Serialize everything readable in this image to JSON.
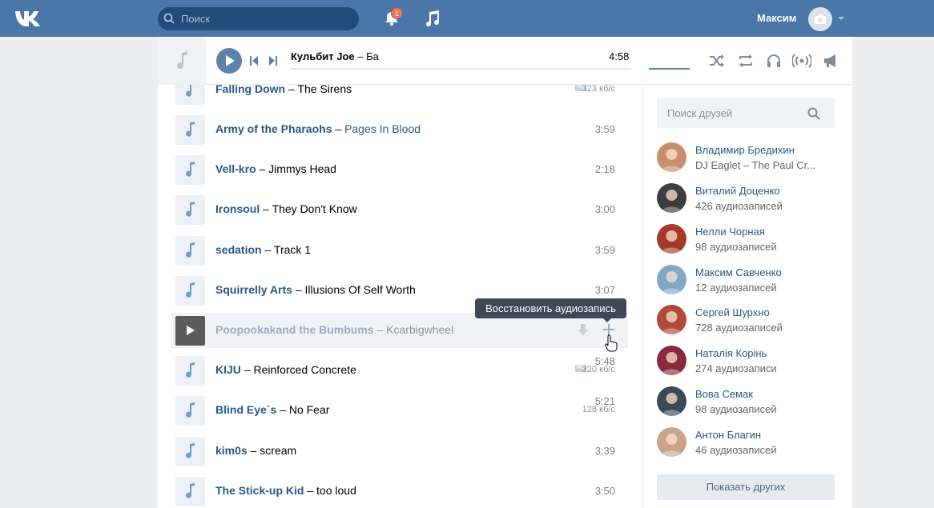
{
  "header": {
    "search_placeholder": "Поиск",
    "notifications_count": "1",
    "user_name": "Максим"
  },
  "player": {
    "artist": "Кульбит Joe",
    "separator": " – ",
    "song": "Ба",
    "time": "4:58"
  },
  "tracks": [
    {
      "artist": "Falling Down",
      "song": "The Sirens",
      "duration": "5:14",
      "bitrate": "323 кб/с",
      "hq": true
    },
    {
      "artist": "Army of the Pharaohs",
      "song": "Pages In Blood",
      "duration": "3:59",
      "song_link": true
    },
    {
      "artist": "Vell-kro",
      "song": "Jimmys Head",
      "duration": "2:18"
    },
    {
      "artist": "Ironsoul",
      "song": "They Don't Know",
      "duration": "3:00"
    },
    {
      "artist": "sedation",
      "song": "Track 1",
      "duration": "3:59"
    },
    {
      "artist": "Squirrelly Arts",
      "song": "Illusions Of Self Worth",
      "duration": "3:07"
    },
    {
      "artist": "Poopookakand the Bumbums",
      "song": "Kcarbigwheel",
      "duration": "",
      "deleted": true
    },
    {
      "artist": "KIJU",
      "song": "Reinforced Concrete",
      "duration": "5:48",
      "bitrate": "320 кб/с",
      "hq": true
    },
    {
      "artist": "Blind Eye`s",
      "song": "No Fear",
      "duration": "5:21",
      "bitrate": "128 кб/с"
    },
    {
      "artist": "kim0s",
      "song": "scream",
      "duration": "3:39"
    },
    {
      "artist": "The Stick-up Kid",
      "song": "too loud",
      "duration": "3:50"
    }
  ],
  "tooltip": "Восстановить аудиозапись",
  "hq_label": "HQ",
  "dash": "–",
  "sidebar": {
    "search_placeholder": "Поиск друзей",
    "friends": [
      {
        "name": "Владимир Бредихин",
        "sub": "DJ Eaglet – The Paul Cr...",
        "color": "#c98e6b"
      },
      {
        "name": "Виталий Доценко",
        "sub": "426 аудиозаписей",
        "color": "#3d3d3d"
      },
      {
        "name": "Нелли Чорная",
        "sub": "98 аудиозаписей",
        "color": "#a33a2a"
      },
      {
        "name": "Максим Савченко",
        "sub": "12 аудиозаписей",
        "color": "#7fa8c9"
      },
      {
        "name": "Сергей Шурхно",
        "sub": "728 аудиозаписей",
        "color": "#b04a3a"
      },
      {
        "name": "Наталія Корінь",
        "sub": "274 аудиозаписи",
        "color": "#8a2a3a"
      },
      {
        "name": "Вова Семак",
        "sub": "98 аудиозаписей",
        "color": "#3a4a5a"
      },
      {
        "name": "Антон Благин",
        "sub": "46 аудиозаписей",
        "color": "#c7a58a"
      }
    ],
    "show_more": "Показать других"
  },
  "colors": {
    "header_bg": "#4a76a8",
    "link": "#2a5885",
    "accent": "#5e81a8"
  }
}
